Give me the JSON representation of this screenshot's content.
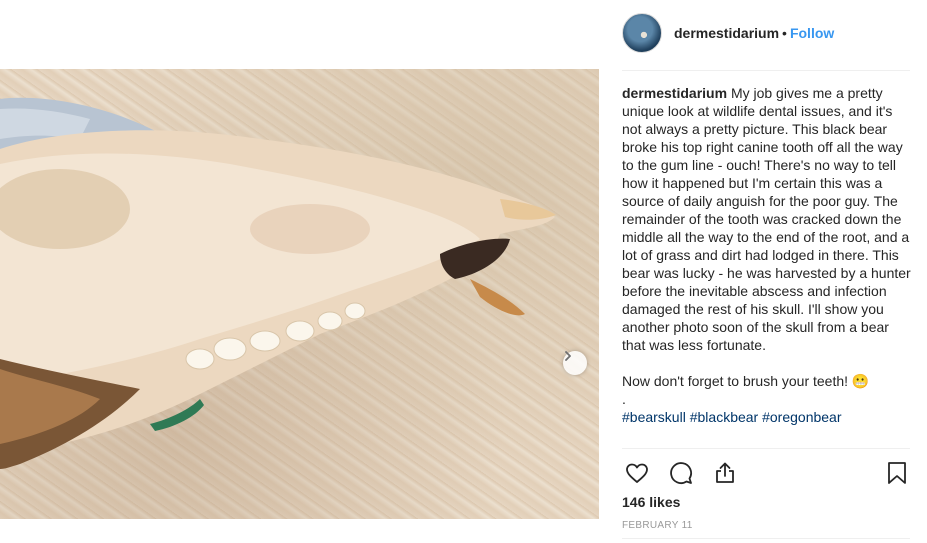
{
  "post": {
    "image_alt": "",
    "username": "dermestidarium",
    "separator": "•",
    "follow_label": "Follow",
    "caption_user": "dermestidarium",
    "caption_text": "My job gives me a pretty unique look at wildlife dental issues, and it's not always a pretty picture. This black bear broke his top right canine tooth off all the way to the gum line - ouch! There's no way to tell how it happened but I'm certain this was a source of daily anguish for the poor guy. The remainder of the tooth was cracked down the middle all the way to the end of the root, and a lot of grass and dirt had lodged in there. This bear was lucky - he was harvested by a hunter before the inevitable abscess and infection damaged the rest of his skull. I'll show you another photo soon of the skull from a bear that was less fortunate.",
    "caption_line2": "Now don't forget to brush your teeth! 😬",
    "caption_dot": ".",
    "hashtags": [
      "#bearskull",
      "#blackbear",
      "#oregonbear"
    ],
    "likes": "146 likes",
    "date": "FEBRUARY 11"
  },
  "icons": {
    "next": "chevron-right-icon",
    "like": "heart-icon",
    "comment": "comment-icon",
    "share": "share-icon",
    "save": "bookmark-icon"
  }
}
